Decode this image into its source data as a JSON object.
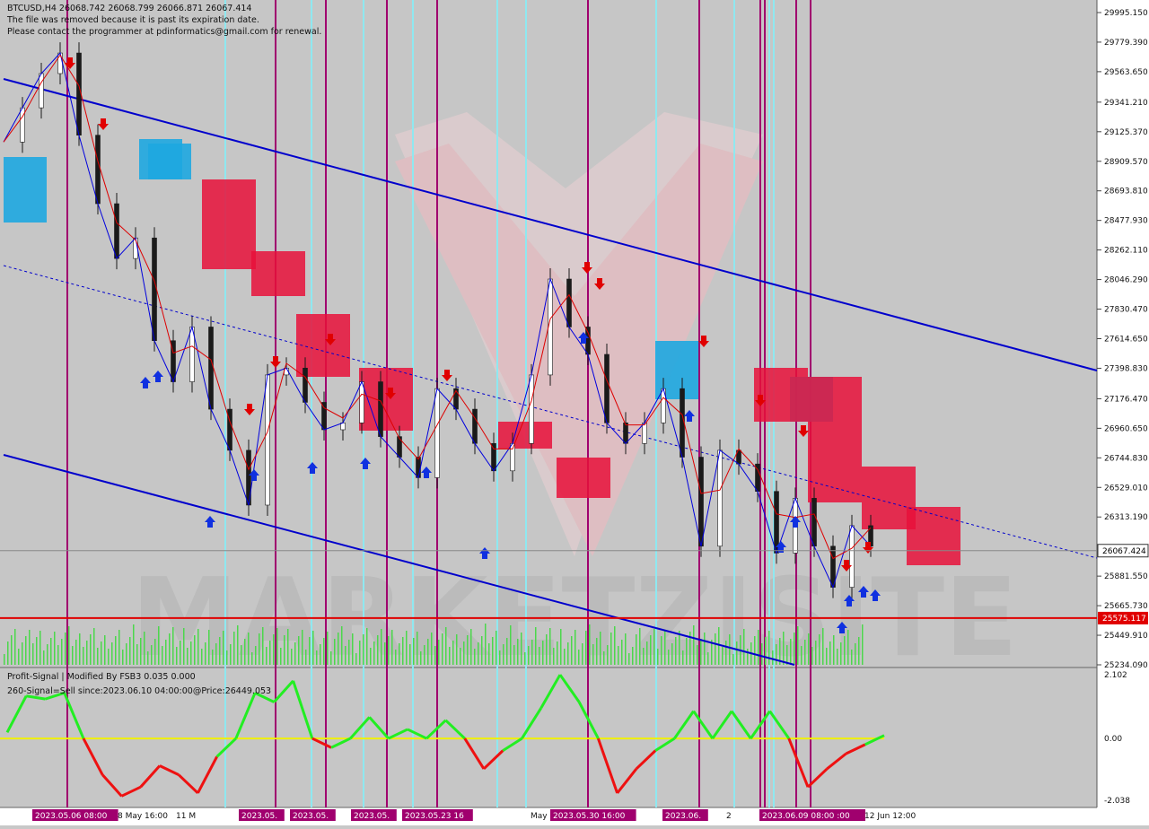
{
  "header": {
    "symbol_line": "BTCUSD,H4  26068.742 26068.799 26066.871 26067.414",
    "notice_1": "The file was removed because it is past its expiration date.",
    "notice_2": "Please contact the programmer at pdinformatics@gmail.com for renewal."
  },
  "indicator": {
    "title": "Profit-Signal | Modified By FSB3 0.035 0.000",
    "signal_text": "260-Signal=Sell since:2023.06.10 04:00:00@Price:26449.053"
  },
  "watermark": "MARKETZISITE",
  "price_tags": {
    "current": "26067.424",
    "support": "25575.117"
  },
  "colors": {
    "background": "#c8c8c8",
    "channel": "#0000cc",
    "bull_cloud": "#1ea7e0",
    "bear_cloud": "#e8103a",
    "support_line": "#e00000",
    "magenta_vline": "#a0006e",
    "cyan_vline": "#8fe8f0",
    "buy_arrow": "#1030e0",
    "sell_arrow": "#e00000",
    "osc_up": "#22ee22",
    "osc_down": "#ee1111",
    "osc_zero": "#f0f000"
  },
  "chart_data": {
    "type": "line",
    "title": "BTCUSD,H4",
    "y_axis": {
      "range": [
        25234.09,
        29995.15
      ],
      "ticks": [
        "29995.150",
        "29779.390",
        "29563.650",
        "29341.210",
        "29125.370",
        "28909.570",
        "28693.810",
        "28477.930",
        "28262.110",
        "28046.290",
        "27830.470",
        "27614.650",
        "27398.830",
        "27176.470",
        "26960.650",
        "26744.830",
        "26529.010",
        "26313.190",
        "25881.550",
        "25665.730",
        "25449.910",
        "25234.090"
      ]
    },
    "x_axis": {
      "time_labels": [
        "2023.05.06 08:00",
        "8 May 16:00",
        "11 M",
        "2023.05.",
        "2023.05.",
        "2023.05.",
        "2023.05.23 16",
        "May",
        "2023.05.30 16:00",
        "2023.06.",
        "2",
        "2023.06.09 08:00 :00",
        "12 Jun 12:00"
      ]
    },
    "series": [
      {
        "name": "BTCUSD close",
        "values": [
          29050,
          29300,
          29550,
          29700,
          29100,
          28600,
          28200,
          28350,
          27600,
          27300,
          27700,
          27100,
          26800,
          26400,
          27350,
          27400,
          27150,
          26950,
          27000,
          27300,
          26900,
          26750,
          26600,
          27250,
          27100,
          26850,
          26650,
          26850,
          27350,
          28050,
          27700,
          27500,
          27000,
          26850,
          27000,
          27250,
          26750,
          26100,
          26800,
          26700,
          26500,
          26050,
          26450,
          26100,
          25800,
          26250,
          26100
        ]
      },
      {
        "name": "Profit-Signal",
        "values": [
          0.2,
          1.4,
          1.3,
          1.5,
          0.0,
          -1.2,
          -1.9,
          -1.6,
          -0.9,
          -1.2,
          -1.8,
          -0.6,
          0.0,
          1.5,
          1.2,
          1.9,
          0.0,
          -0.3,
          0.0,
          0.7,
          0.0,
          0.3,
          0.0,
          0.6,
          0.0,
          -1.0,
          -0.4,
          0.0,
          1.0,
          2.1,
          1.2,
          0.0,
          -1.8,
          -1.0,
          -0.4,
          0.0,
          0.9,
          0.0,
          0.9,
          0.0,
          0.9,
          0.0,
          -1.6,
          -1.0,
          -0.5,
          -0.2,
          0.1
        ]
      }
    ],
    "levels": {
      "current_price": 26067.424,
      "support": 25575.117
    },
    "oscillator_axis": {
      "range": [
        -2.038,
        2.102
      ],
      "ticks": [
        "2.102",
        "0.00",
        "-2.038"
      ]
    }
  }
}
